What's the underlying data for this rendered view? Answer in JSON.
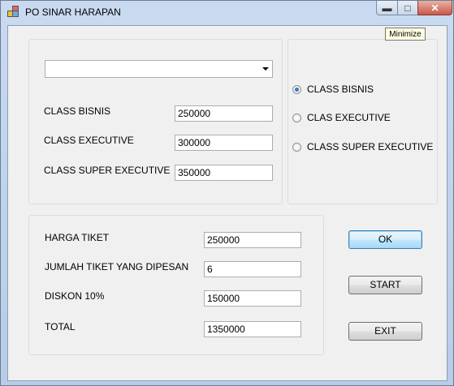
{
  "window": {
    "title": "PO SINAR HARAPAN"
  },
  "tooltip": "Minimize",
  "combo": {
    "value": ""
  },
  "prices": [
    {
      "label": "CLASS BISNIS",
      "value": "250000"
    },
    {
      "label": "CLASS EXECUTIVE",
      "value": "300000"
    },
    {
      "label": "CLASS SUPER EXECUTIVE",
      "value": "350000"
    }
  ],
  "classes": [
    {
      "label": "CLASS BISNIS",
      "selected": true
    },
    {
      "label": "CLAS EXECUTIVE",
      "selected": false
    },
    {
      "label": "CLASS SUPER EXECUTIVE",
      "selected": false
    }
  ],
  "summary": [
    {
      "label": "HARGA TIKET",
      "value": "250000"
    },
    {
      "label": "JUMLAH TIKET YANG DIPESAN",
      "value": "6"
    },
    {
      "label": "DISKON 10%",
      "value": "150000"
    },
    {
      "label": "TOTAL",
      "value": "1350000"
    }
  ],
  "buttons": {
    "ok": "OK",
    "start": "START",
    "exit": "EXIT"
  }
}
